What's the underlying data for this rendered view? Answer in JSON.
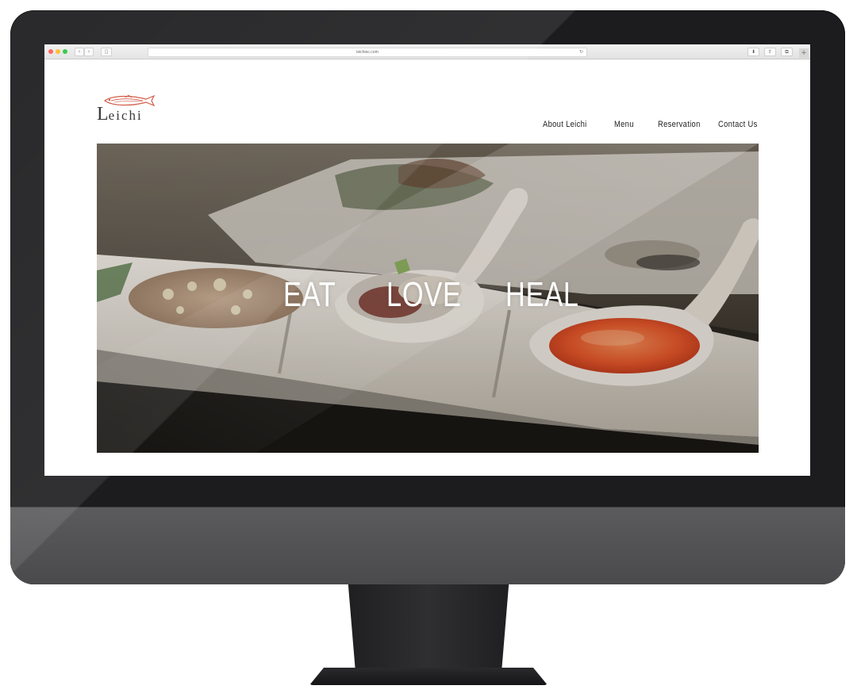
{
  "browser": {
    "url": "leichioc.com",
    "back_glyph": "‹",
    "forward_glyph": "›",
    "sidebar_glyph": "▯",
    "reload_glyph": "↻",
    "download_glyph": "⬇",
    "share_glyph": "⇧",
    "tabs_glyph": "⧉",
    "new_tab_glyph": "+"
  },
  "site": {
    "logo_text_initial": "L",
    "logo_text_rest": "eichi",
    "nav": {
      "about": "About Leichi",
      "menu": "Menu",
      "reservation": "Reservation",
      "contact": "Contact Us"
    },
    "hero": {
      "word_1": "EAT",
      "word_2": "LOVE",
      "word_3": "HEAL"
    }
  },
  "colors": {
    "logo_fish": "#d0503a",
    "monitor_bezel": "#1c1c1e",
    "roe_sauce": "#e2562a"
  },
  "icons": {
    "traffic_lights": [
      "close-icon",
      "minimize-icon",
      "maximize-icon"
    ],
    "logo": "fish-icon"
  }
}
